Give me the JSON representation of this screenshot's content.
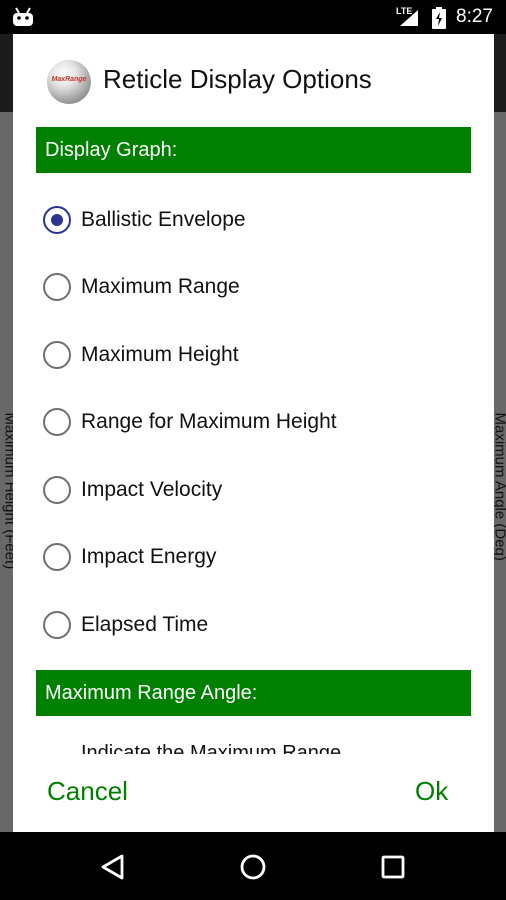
{
  "status_bar": {
    "time": "8:27",
    "network_label": "LTE",
    "icons": [
      "android-icon",
      "signal-icon",
      "battery-icon"
    ]
  },
  "background": {
    "left_axis_text": "Maximum Height (Feet)",
    "right_axis_text": "Maximum Angle (Deg)"
  },
  "dialog": {
    "logo_text": "MaxRange",
    "title": "Reticle Display Options",
    "section_display_graph": "Display Graph:",
    "options": [
      {
        "label": "Ballistic Envelope",
        "selected": true
      },
      {
        "label": "Maximum Range",
        "selected": false
      },
      {
        "label": "Maximum Height",
        "selected": false
      },
      {
        "label": "Range for Maximum Height",
        "selected": false
      },
      {
        "label": "Impact Velocity",
        "selected": false
      },
      {
        "label": "Impact Energy",
        "selected": false
      },
      {
        "label": "Elapsed Time",
        "selected": false
      }
    ],
    "section_max_range_angle": "Maximum Range Angle:",
    "clipped_text": "Indicate the Maximum Range",
    "cancel_label": "Cancel",
    "ok_label": "Ok"
  },
  "colors": {
    "accent_green": "#008000",
    "radio_selected": "#283593",
    "radio_unselected": "#6f6f6f"
  },
  "nav_bar": {
    "icons": [
      "back-icon",
      "home-icon",
      "recents-icon"
    ]
  }
}
